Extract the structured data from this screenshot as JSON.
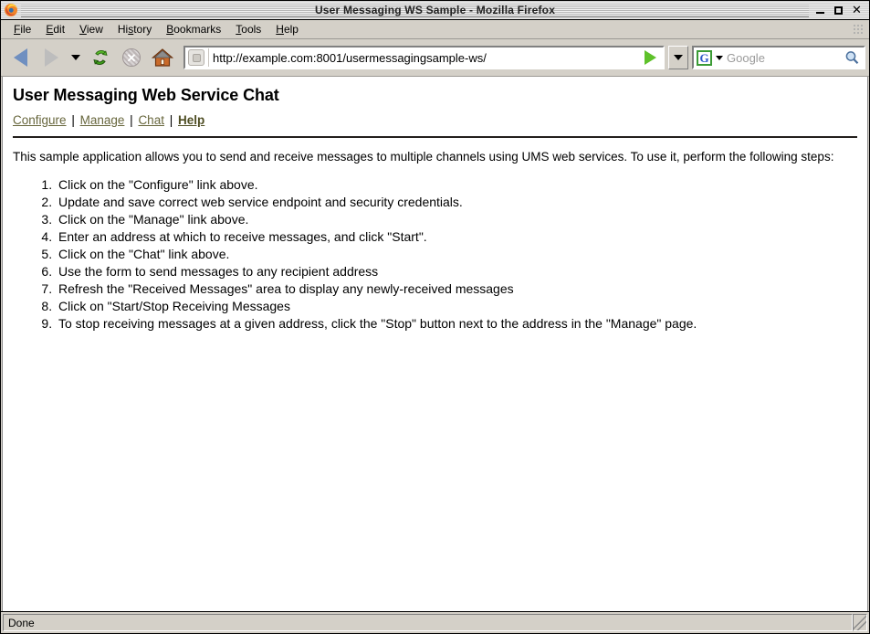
{
  "window": {
    "title": "User Messaging WS Sample - Mozilla Firefox",
    "app_icon": "firefox-logo-icon",
    "controls": {
      "minimize": "minimize-icon",
      "maximize": "maximize-icon",
      "close": "✕"
    }
  },
  "menubar": {
    "items": [
      {
        "label": "File",
        "mnemonic": "F"
      },
      {
        "label": "Edit",
        "mnemonic": "E"
      },
      {
        "label": "View",
        "mnemonic": "V"
      },
      {
        "label": "History",
        "mnemonic": "s"
      },
      {
        "label": "Bookmarks",
        "mnemonic": "B"
      },
      {
        "label": "Tools",
        "mnemonic": "T"
      },
      {
        "label": "Help",
        "mnemonic": "H"
      }
    ]
  },
  "toolbar": {
    "back": "back-arrow-icon",
    "forward": "forward-arrow-icon",
    "history_dropdown": "chevron-down-icon",
    "reload": "reload-icon",
    "stop": "stop-icon",
    "home": "home-icon",
    "url": {
      "value": "http://example.com:8001/usermessagingsample-ws/",
      "favicon": "page-favicon-icon",
      "go": "go-arrow-icon",
      "dropdown": "chevron-down-icon"
    },
    "search": {
      "engine": "G",
      "engine_dropdown": "chevron-down-icon",
      "placeholder": "Google",
      "submit": "magnifier-icon"
    }
  },
  "page": {
    "title": "User Messaging Web Service Chat",
    "nav": {
      "separator": "|",
      "links": [
        {
          "label": "Configure",
          "current": false
        },
        {
          "label": "Manage",
          "current": false
        },
        {
          "label": "Chat",
          "current": false
        },
        {
          "label": "Help",
          "current": true
        }
      ]
    },
    "intro": "This sample application allows you to send and receive messages to multiple channels using UMS web services. To use it, perform the following steps:",
    "steps": [
      "Click on the \"Configure\" link above.",
      "Update and save correct web service endpoint and security credentials.",
      "Click on the \"Manage\" link above.",
      "Enter an address at which to receive messages, and click \"Start\".",
      "Click on the \"Chat\" link above.",
      "Use the form to send messages to any recipient address",
      "Refresh the \"Received Messages\" area to display any newly-received messages",
      "Click on \"Start/Stop Receiving Messages",
      "To stop receiving messages at a given address, click the \"Stop\" button next to the address in the \"Manage\" page."
    ]
  },
  "statusbar": {
    "text": "Done",
    "resize_grip": "resize-grip-icon"
  },
  "colors": {
    "chrome": "#d4d0c8",
    "link": "#67663c",
    "go_arrow": "#5ec12a",
    "back_arrow": "#6f8fc0",
    "content_bg": "#ffffff"
  }
}
